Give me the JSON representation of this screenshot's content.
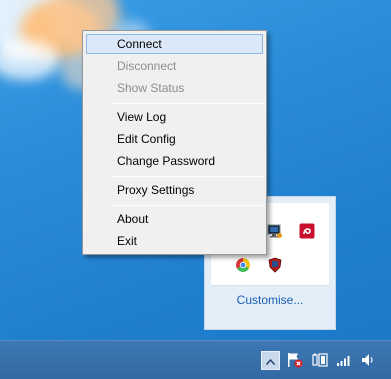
{
  "context_menu": {
    "items": [
      {
        "label": "Connect",
        "enabled": true,
        "highlighted": true
      },
      {
        "label": "Disconnect",
        "enabled": false
      },
      {
        "label": "Show Status",
        "enabled": false
      },
      {
        "label": "View Log",
        "enabled": true
      },
      {
        "label": "Edit Config",
        "enabled": true
      },
      {
        "label": "Change Password",
        "enabled": true
      },
      {
        "label": "Proxy Settings",
        "enabled": true
      },
      {
        "label": "About",
        "enabled": true
      },
      {
        "label": "Exit",
        "enabled": true
      }
    ]
  },
  "tray_flyout": {
    "customise_label": "Customise...",
    "icons": [
      "openvpn-monitor-icon",
      "red-app-icon",
      "chrome-icon",
      "red-shield-icon"
    ]
  },
  "taskbar": {
    "icons": [
      "show-hidden-icons-icon",
      "action-center-flag-icon",
      "power-icon",
      "network-signal-icon",
      "volume-icon"
    ]
  },
  "colors": {
    "desktop": "#2a8bd8",
    "taskbar": "#3a70ad",
    "menu_bg": "#f0f0f0",
    "menu_highlight": "#dbe8f7",
    "link": "#1a5fb4"
  }
}
